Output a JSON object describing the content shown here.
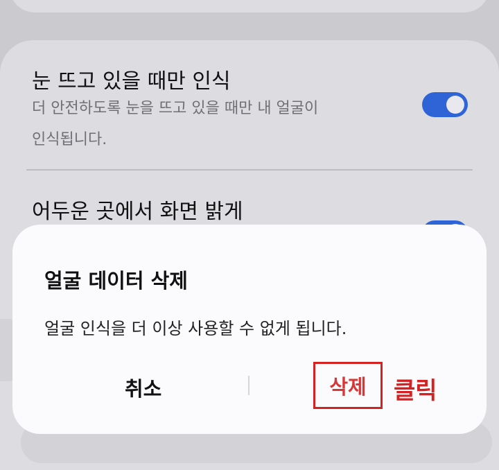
{
  "settings": {
    "eyes_open": {
      "title": "눈 뜨고 있을 때만 인식",
      "desc_line1": "더 안전하도록 눈을 뜨고 있을 때만 내 얼굴이",
      "desc_line2": "인식됩니다.",
      "enabled": true
    },
    "brighten": {
      "title": "어두운 곳에서 화면 밝게",
      "enabled": true
    }
  },
  "dialog": {
    "title": "얼굴 데이터 삭제",
    "message": "얼굴 인식을 더 이상 사용할 수 없게 됩니다.",
    "cancel_label": "취소",
    "delete_label": "삭제"
  },
  "annotation": {
    "label": "클릭",
    "color": "#d42222"
  },
  "colors": {
    "toggle_on": "#2f64d6",
    "delete_text": "#d63838"
  }
}
